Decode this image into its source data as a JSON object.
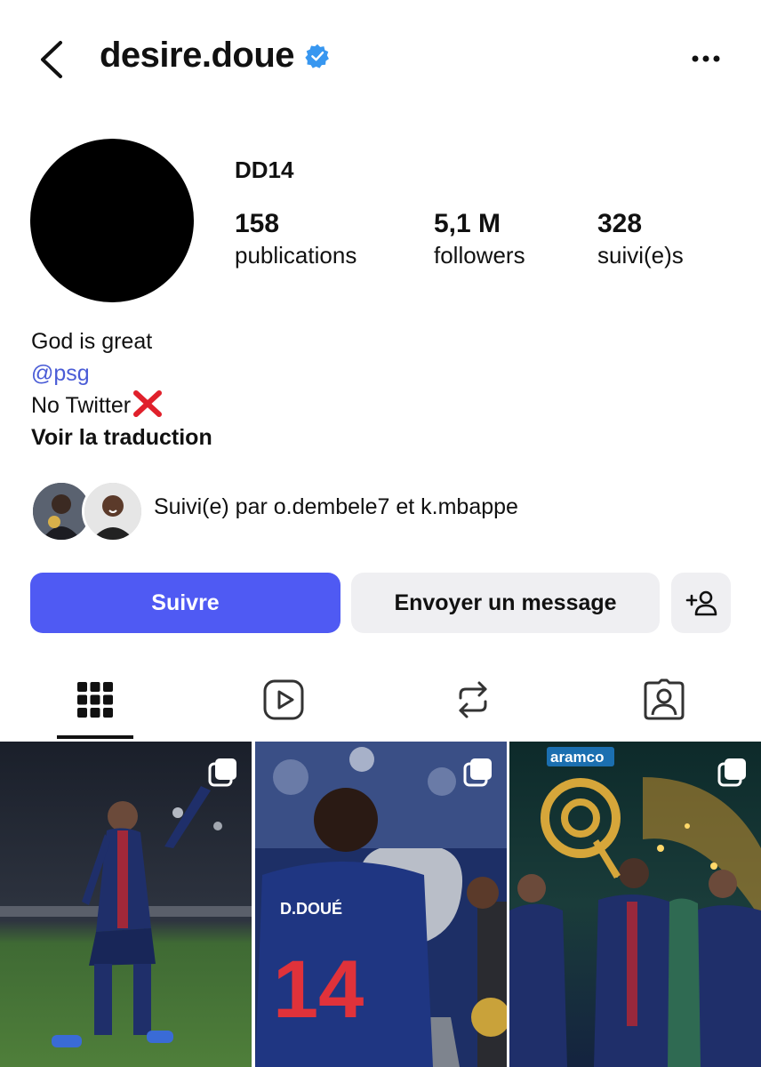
{
  "header": {
    "username": "desire.doue",
    "back_icon": "chevron-left-icon",
    "verified_icon": "verified-badge-icon",
    "more_icon": "more-horizontal-icon"
  },
  "profile": {
    "display_name": "DD14",
    "stats": [
      {
        "value": "158",
        "label": "publications"
      },
      {
        "value": "5,1 M",
        "label": "followers"
      },
      {
        "value": "328",
        "label": "suivi(e)s"
      }
    ],
    "bio": {
      "line1": "God is great",
      "mention": "@psg",
      "line3": "No Twitter",
      "translate": "Voir la traduction"
    },
    "followed_by": "Suivi(e) par o.dembele7 et k.mbappe"
  },
  "actions": {
    "follow": "Suivre",
    "message": "Envoyer un message",
    "add_icon": "add-person-icon"
  },
  "tabs": [
    {
      "icon": "grid-icon",
      "active": true
    },
    {
      "icon": "reels-icon",
      "active": false
    },
    {
      "icon": "reposts-icon",
      "active": false
    },
    {
      "icon": "tagged-icon",
      "active": false
    }
  ],
  "posts": [
    {
      "icon": "carousel-icon"
    },
    {
      "icon": "carousel-icon",
      "text": "D.DOUÉ",
      "number": "14"
    },
    {
      "icon": "carousel-icon",
      "text": "aramco"
    }
  ],
  "colors": {
    "accent": "#4f5af3",
    "link": "#4a5cd6",
    "verified": "#3897f0",
    "button_secondary": "#efeff2"
  }
}
